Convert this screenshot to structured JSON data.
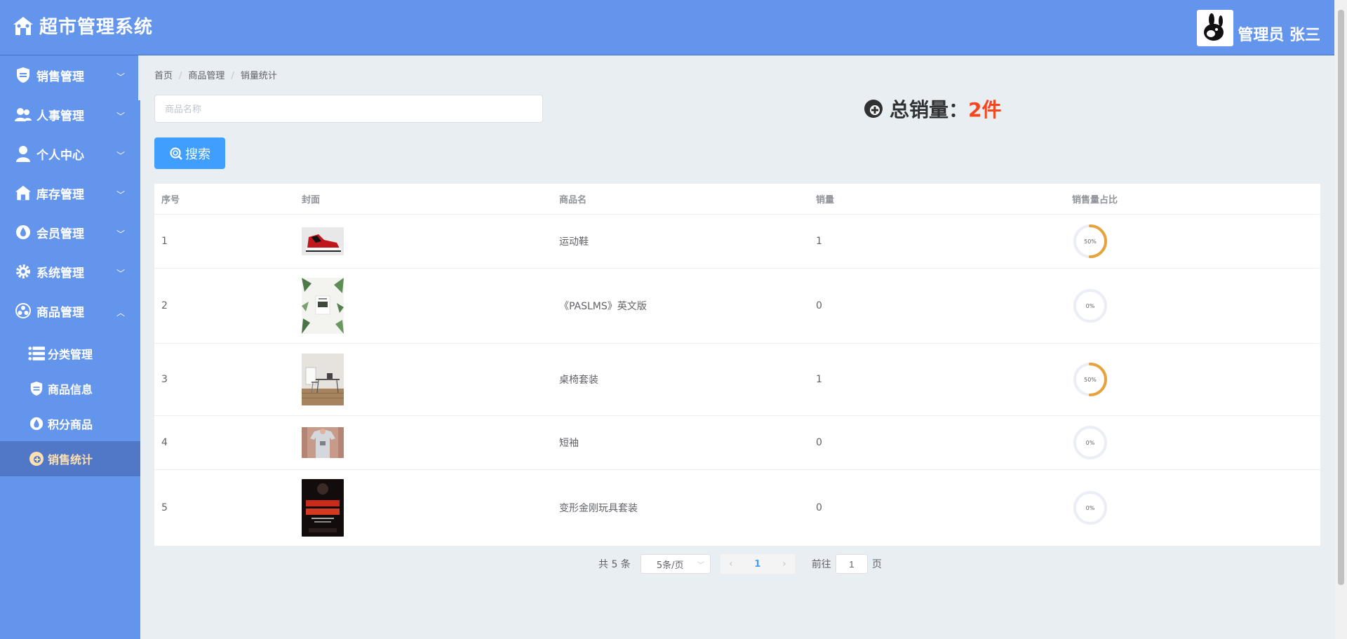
{
  "header": {
    "title": "超市管理系统",
    "user_label": "管理员 张三"
  },
  "sidebar": {
    "items": [
      {
        "label": "销售管理",
        "icon": "shield-icon"
      },
      {
        "label": "人事管理",
        "icon": "users-icon"
      },
      {
        "label": "个人中心",
        "icon": "person-icon"
      },
      {
        "label": "库存管理",
        "icon": "house-icon"
      },
      {
        "label": "会员管理",
        "icon": "drop-icon"
      },
      {
        "label": "系统管理",
        "icon": "gear-icon"
      },
      {
        "label": "商品管理",
        "icon": "goods-icon"
      }
    ],
    "sub_items": [
      {
        "label": "分类管理",
        "icon": "list-icon"
      },
      {
        "label": "商品信息",
        "icon": "shield-icon"
      },
      {
        "label": "积分商品",
        "icon": "drop-icon"
      },
      {
        "label": "销售统计",
        "icon": "stat-icon",
        "active": true
      }
    ]
  },
  "breadcrumb": {
    "items": [
      "首页",
      "商品管理",
      "销量统计"
    ]
  },
  "search": {
    "placeholder": "商品名称",
    "button_label": "搜索"
  },
  "summary": {
    "label": "总销量：",
    "value": "2件"
  },
  "table": {
    "columns": [
      "序号",
      "封面",
      "商品名",
      "销量",
      "销售量占比"
    ],
    "rows": [
      {
        "index": "1",
        "name": "运动鞋",
        "sales": "1",
        "ratio_label": "50%",
        "ratio": 0.5,
        "cover": "sneaker"
      },
      {
        "index": "2",
        "name": "《PASLMS》英文版",
        "sales": "0",
        "ratio_label": "0%",
        "ratio": 0,
        "cover": "book"
      },
      {
        "index": "3",
        "name": "桌椅套装",
        "sales": "1",
        "ratio_label": "50%",
        "ratio": 0.5,
        "cover": "desk"
      },
      {
        "index": "4",
        "name": "短袖",
        "sales": "0",
        "ratio_label": "0%",
        "ratio": 0,
        "cover": "shirt"
      },
      {
        "index": "5",
        "name": "变形金刚玩具套装",
        "sales": "0",
        "ratio_label": "0%",
        "ratio": 0,
        "cover": "poster"
      }
    ]
  },
  "pagination": {
    "total_text": "共 5 条",
    "page_size": "5条/页",
    "current_page": "1",
    "goto_prefix": "前往",
    "goto_value": "1",
    "goto_suffix": "页"
  },
  "colors": {
    "brand": "#6495ed",
    "accent": "#409eff",
    "ring": "#e6a23c",
    "ring_track": "#ebeef5",
    "total_value": "#f5461e"
  }
}
